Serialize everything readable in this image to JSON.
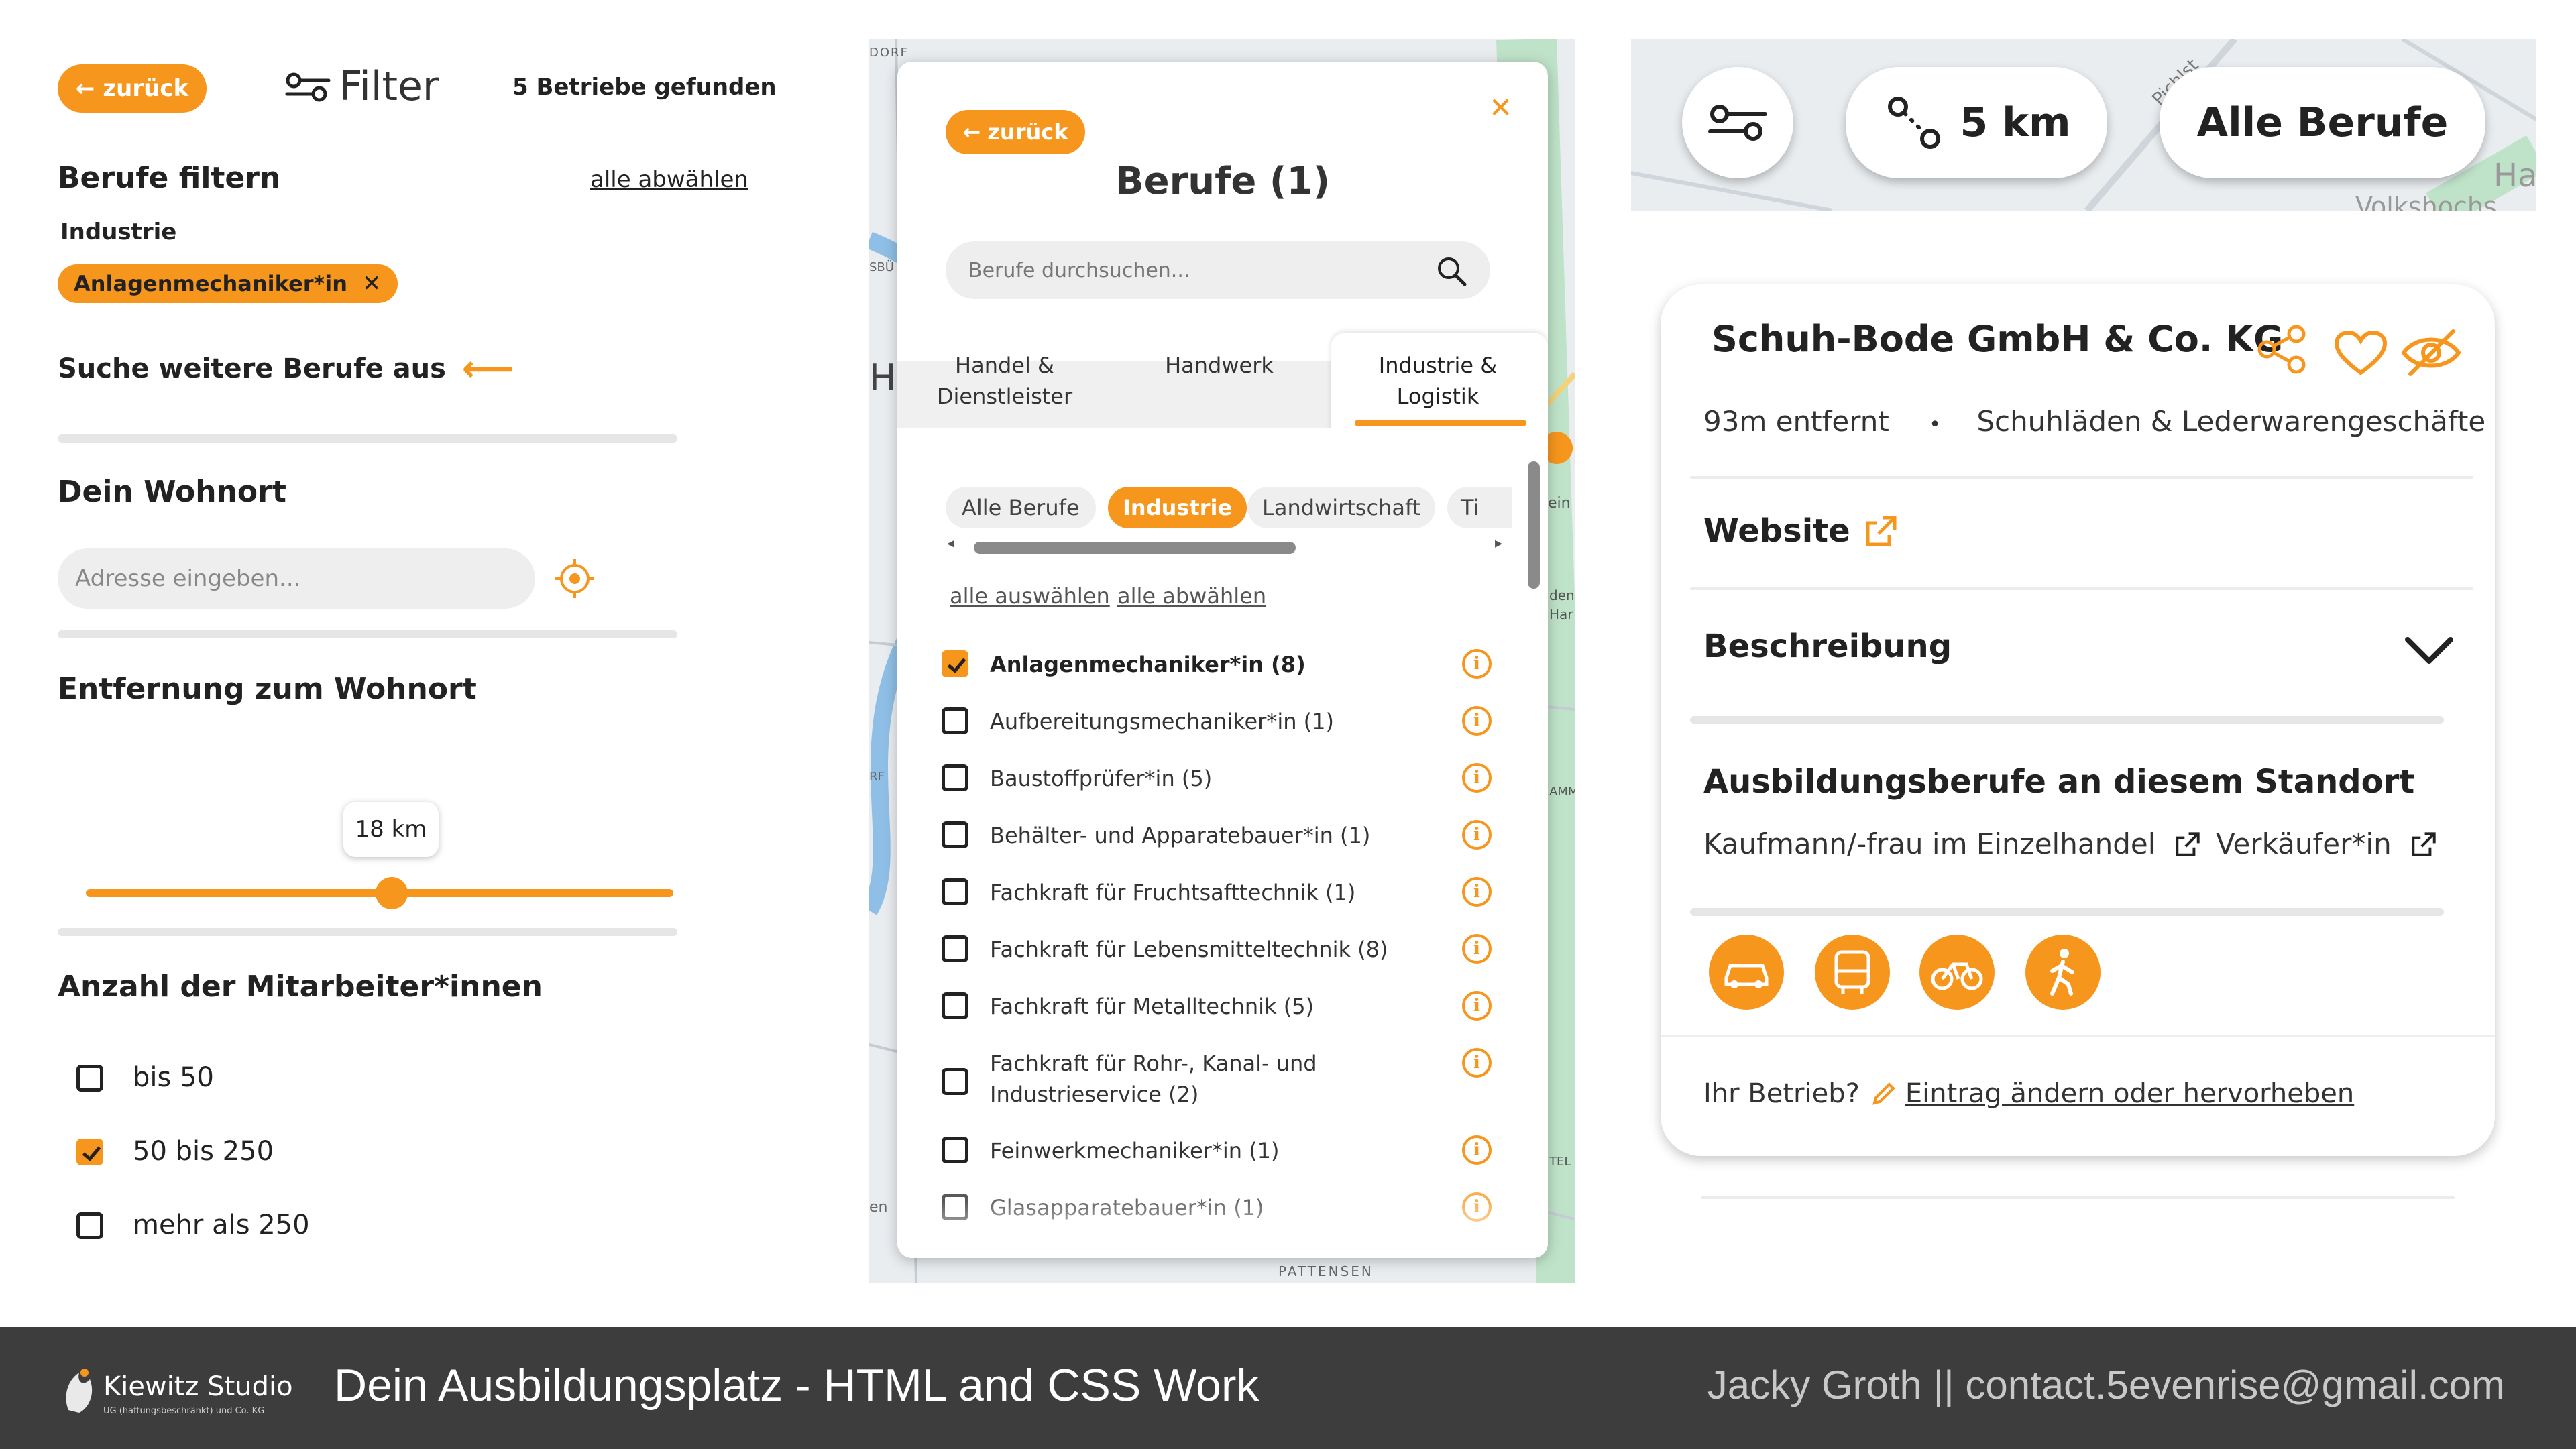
{
  "panel1": {
    "back_label": "zurück",
    "filter_title": "Filter",
    "results_count": "5 Betriebe gefunden",
    "berufe_title": "Berufe filtern",
    "deselect_all": "alle abwählen",
    "category": "Industrie",
    "selected_chip": "Anlagenmechaniker*in",
    "more_jobs": "Suche weitere Berufe aus",
    "wohnort_title": "Dein Wohnort",
    "address_placeholder": "Adresse eingeben...",
    "distance_title": "Entfernung zum Wohnort",
    "distance_value": "18 km",
    "distance_fraction": 0.52,
    "employees_title": "Anzahl der Mitarbeiter*innen",
    "employee_options": [
      {
        "label": "bis 50",
        "checked": false
      },
      {
        "label": "50 bis 250",
        "checked": true
      },
      {
        "label": "mehr als 250",
        "checked": false
      }
    ]
  },
  "panel2": {
    "back_label": "zurück",
    "title": "Berufe (1)",
    "search_placeholder": "Berufe durchsuchen...",
    "tabs": [
      {
        "label": "Handel & Dienstleister",
        "active": false
      },
      {
        "label": "Handwerk",
        "active": false
      },
      {
        "label": "Industrie & Logistik",
        "active": true
      }
    ],
    "chips": [
      {
        "label": "Alle Berufe",
        "active": false
      },
      {
        "label": "Industrie",
        "active": true
      },
      {
        "label": "Landwirtschaft",
        "active": false
      },
      {
        "label": "Ti",
        "active": false
      }
    ],
    "select_all": "alle auswählen",
    "deselect_all": "alle abwählen",
    "jobs": [
      {
        "label": "Anlagenmechaniker*in (8)",
        "checked": true
      },
      {
        "label": "Aufbereitungsmechaniker*in (1)",
        "checked": false
      },
      {
        "label": "Baustoffprüfer*in (5)",
        "checked": false
      },
      {
        "label": "Behälter- und Apparatebauer*in (1)",
        "checked": false
      },
      {
        "label": "Fachkraft für Fruchtsafttechnik (1)",
        "checked": false
      },
      {
        "label": "Fachkraft für Lebensmitteltechnik (8)",
        "checked": false
      },
      {
        "label": "Fachkraft für Metalltechnik (5)",
        "checked": false
      },
      {
        "label": "Fachkraft für Rohr-, Kanal- und",
        "label2": "Industrieservice (2)",
        "checked": false
      },
      {
        "label": "Feinwerkmechaniker*in (1)",
        "checked": false
      },
      {
        "label": "Glasapparatebauer*in (1)",
        "checked": false
      }
    ],
    "map_labels": {
      "top": "DORF",
      "left_h": "H",
      "left_sbu": "SBÜ",
      "left_rf": "RF",
      "left_en": "en",
      "bottom": "PATTENSEN",
      "right_ein": "ein",
      "right_den": "den",
      "right_har": "Har",
      "right_amm": "AMM",
      "right_tel": "TEL"
    }
  },
  "panel3": {
    "distance_button": "5 km",
    "jobs_button": "Alle Berufe",
    "map_labels": {
      "street": "Pichlst",
      "ha": "Ha",
      "volk": "Volkshochs"
    },
    "company_name": "Schuh-Bode GmbH & Co. KG",
    "distance": "93m entfernt",
    "separator": "•",
    "category": "Schuhläden & Lederwarengeschäfte",
    "website_label": "Website",
    "description_label": "Beschreibung",
    "jobs_title": "Ausbildungsberufe an diesem Standort",
    "jobs": [
      "Kaufmann/-frau im Einzelhandel",
      "Verkäufer*in"
    ],
    "owner_prompt": "Ihr Betrieb?",
    "owner_link": "Eintrag ändern oder hervorheben"
  },
  "footer": {
    "logo_name": "Kiewitz Studio",
    "logo_sub": "UG (haftungsbeschränkt) und Co. KG",
    "title": "Dein Ausbildungsplatz - HTML and CSS Work",
    "credit": "Jacky Groth || contact.5evenrise@gmail.com"
  },
  "colors": {
    "accent": "#f7961d",
    "footer_bg": "#3d3d3d",
    "text": "#222222"
  }
}
